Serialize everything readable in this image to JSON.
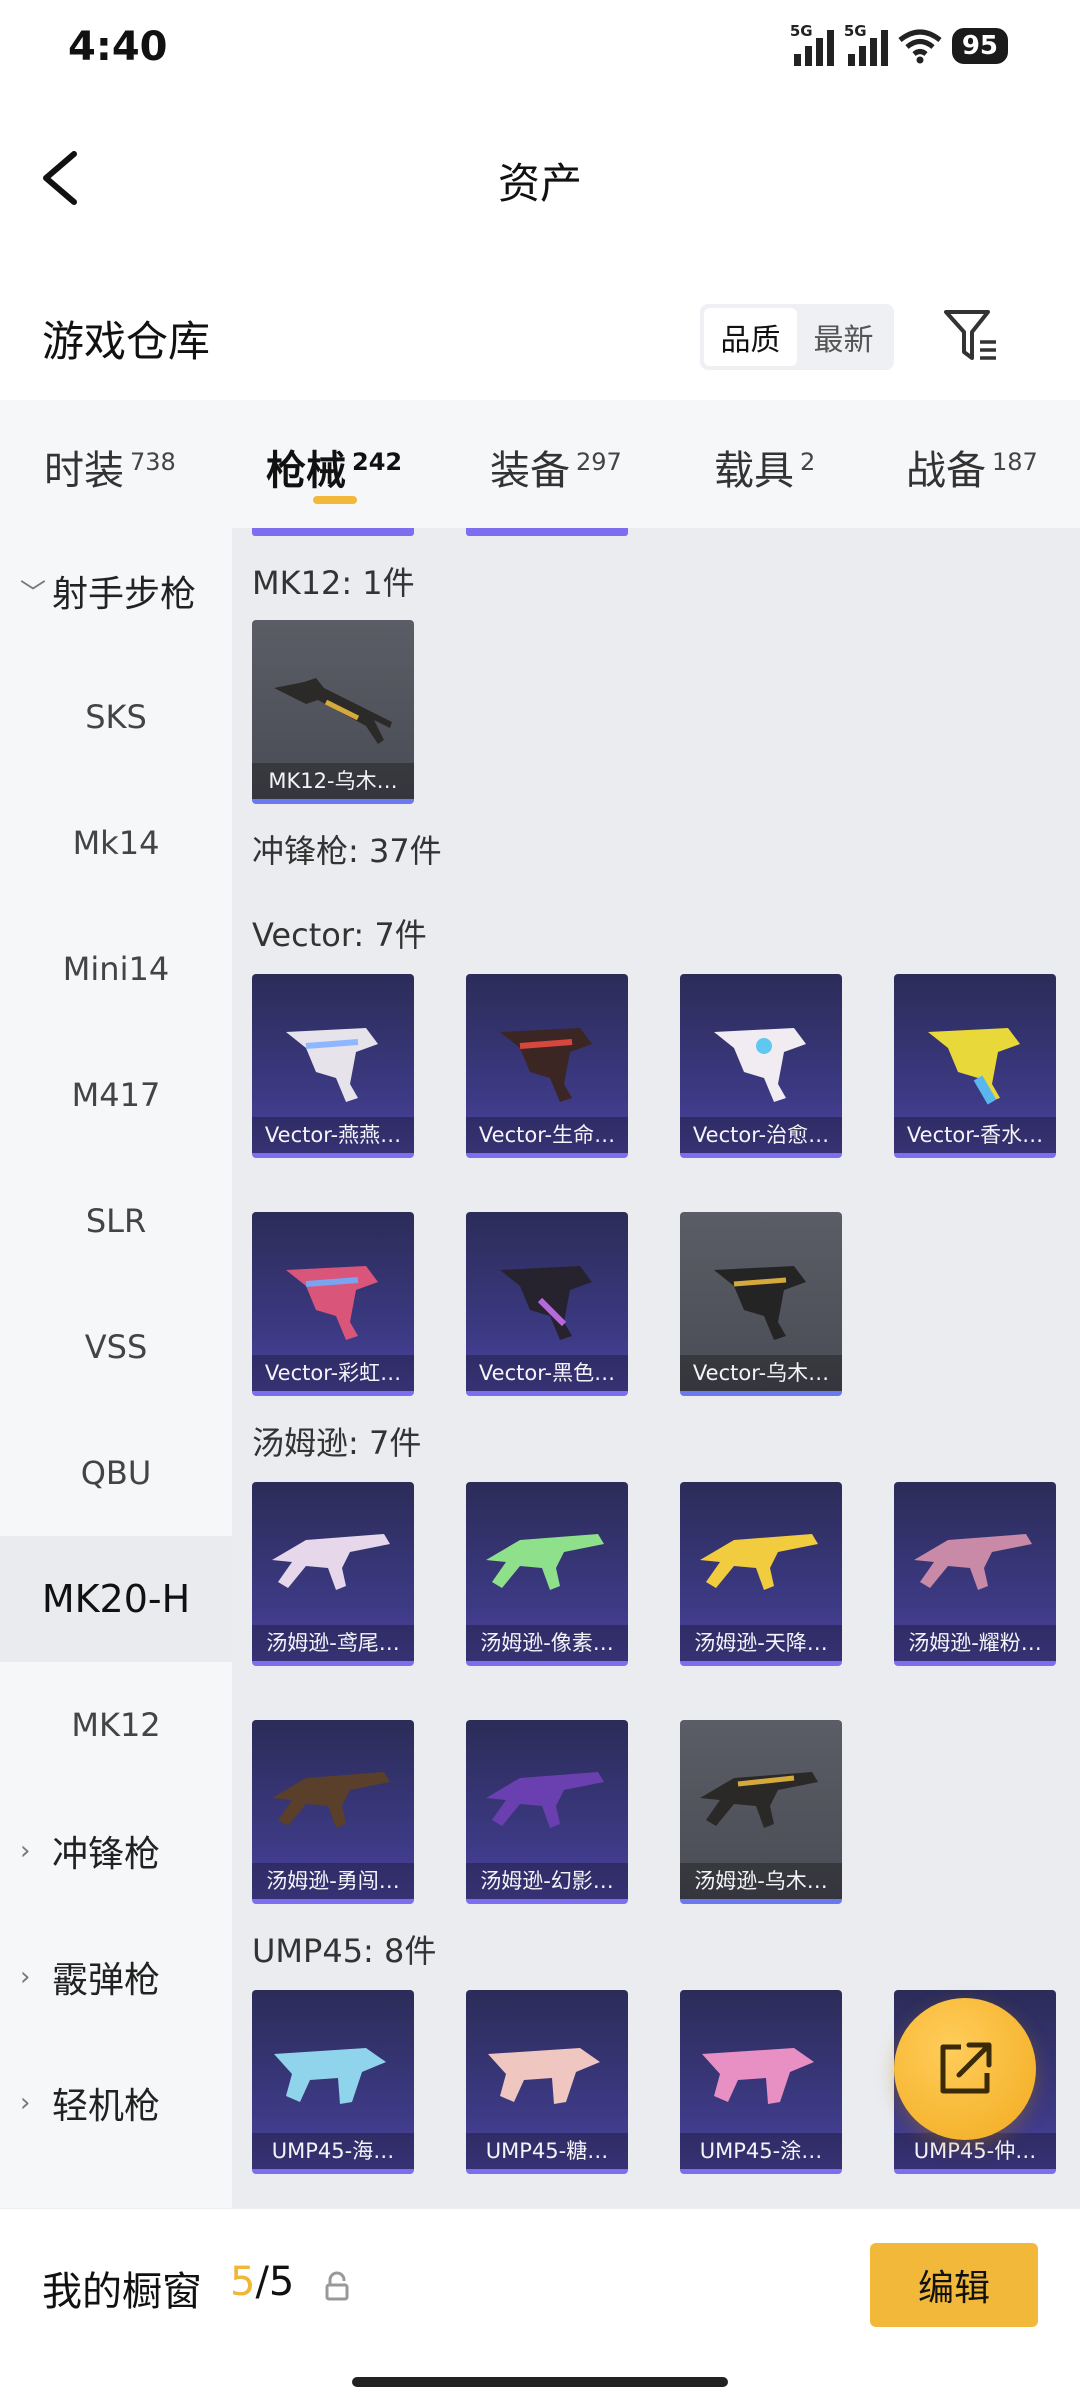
{
  "status": {
    "time": "4:40",
    "signal1": "5G",
    "signal2": "5G",
    "battery": "95"
  },
  "header": {
    "title": "资产"
  },
  "warehouse": {
    "title": "游戏仓库",
    "sort_options": [
      "品质",
      "最新"
    ],
    "active_sort": "品质"
  },
  "tabs": [
    {
      "label": "时装",
      "count": "738"
    },
    {
      "label": "枪械",
      "count": "242",
      "active": true
    },
    {
      "label": "装备",
      "count": "297"
    },
    {
      "label": "载具",
      "count": "2"
    },
    {
      "label": "战备",
      "count": "187"
    }
  ],
  "sidebar": {
    "items": [
      {
        "label": "射手步枪",
        "type": "group",
        "expanded": true
      },
      {
        "label": "SKS"
      },
      {
        "label": "Mk14"
      },
      {
        "label": "Mini14"
      },
      {
        "label": "M417"
      },
      {
        "label": "SLR"
      },
      {
        "label": "VSS"
      },
      {
        "label": "QBU"
      },
      {
        "label": "MK20-H",
        "selected": true
      },
      {
        "label": "MK12"
      },
      {
        "label": "冲锋枪",
        "type": "group"
      },
      {
        "label": "霰弹枪",
        "type": "group"
      },
      {
        "label": "轻机枪",
        "type": "group"
      }
    ]
  },
  "content": {
    "mk12_header": "MK12: 1件",
    "mk12_items": [
      "MK12-乌木…"
    ],
    "smg_header": "冲锋枪: 37件",
    "vector_header": "Vector: 7件",
    "vector_items": [
      "Vector-燕燕…",
      "Vector-生命…",
      "Vector-治愈…",
      "Vector-香水…",
      "Vector-彩虹…",
      "Vector-黑色…",
      "Vector-乌木…"
    ],
    "thompson_header": "汤姆逊: 7件",
    "thompson_items": [
      "汤姆逊-鸢尾…",
      "汤姆逊-像素…",
      "汤姆逊-天降…",
      "汤姆逊-耀粉…",
      "汤姆逊-勇闯…",
      "汤姆逊-幻影…",
      "汤姆逊-乌木…"
    ],
    "ump_header": "UMP45: 8件",
    "ump_items": [
      "UMP45-海…",
      "UMP45-糖…",
      "UMP45-涂…",
      "UMP45-仲…"
    ]
  },
  "bottom": {
    "showcase_label": "我的橱窗",
    "showcase_current": "5",
    "showcase_total": "/5",
    "edit_label": "编辑"
  },
  "colors": {
    "accent": "#f2b83a",
    "card_purple": "#3d3a85",
    "rarity_bar": "#7d6ef0"
  }
}
